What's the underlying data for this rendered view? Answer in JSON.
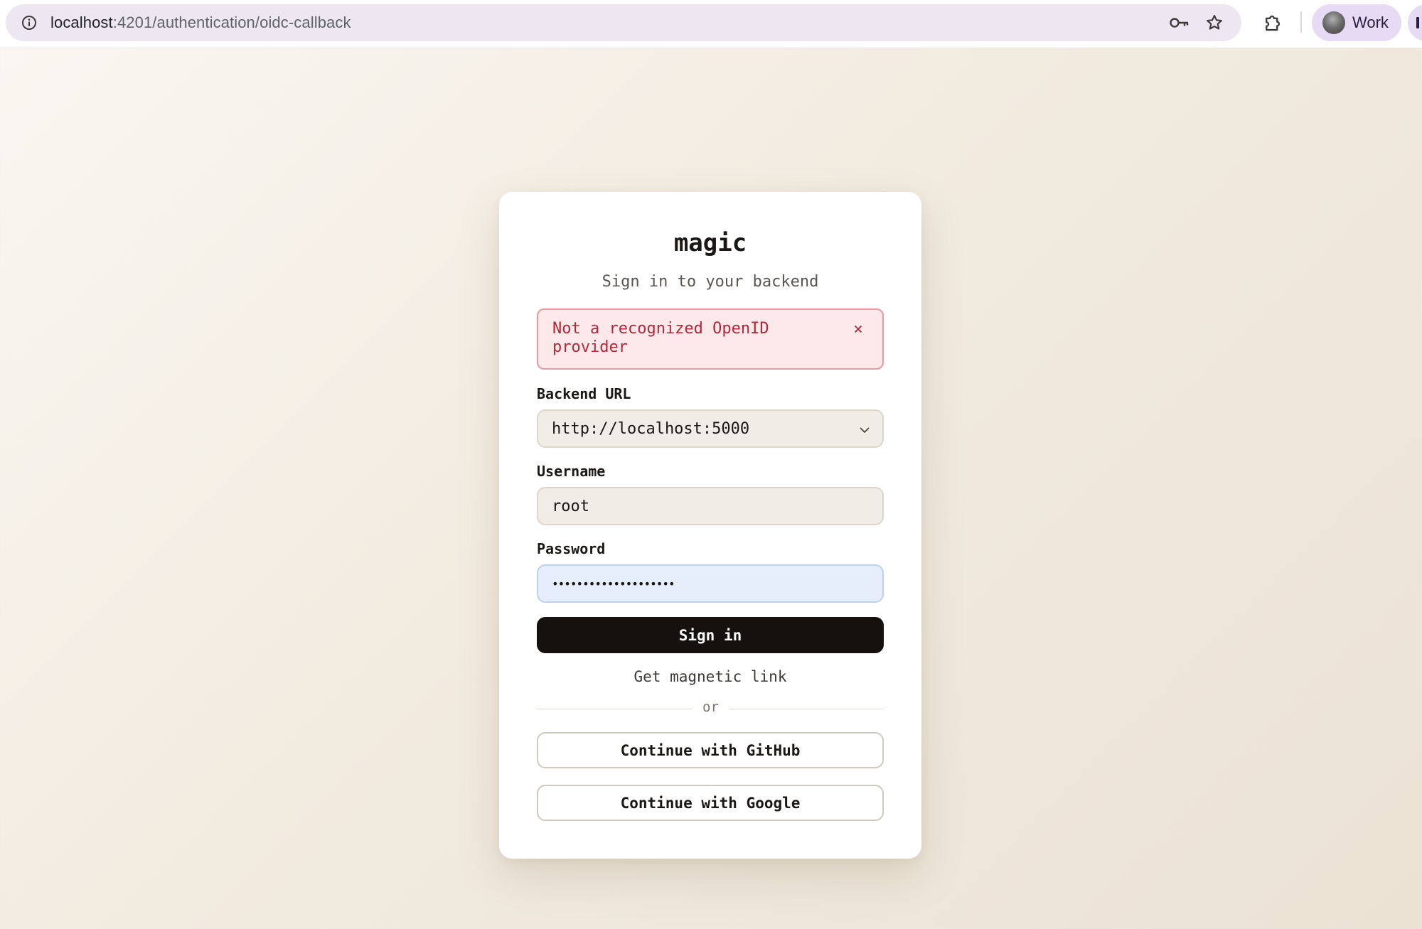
{
  "browser": {
    "url_host": "localhost",
    "url_path": ":4201/authentication/oidc-callback",
    "profile_label": "Work"
  },
  "card": {
    "title": "magic",
    "subtitle": "Sign in to your backend",
    "alert": {
      "message": "Not a recognized OpenID provider",
      "close_glyph": "×"
    },
    "backend_url": {
      "label": "Backend URL",
      "value": "http://localhost:5000"
    },
    "username": {
      "label": "Username",
      "value": "root"
    },
    "password": {
      "label": "Password",
      "masked_value": "••••••••••••••••••••"
    },
    "sign_in_label": "Sign in",
    "magic_link_label": "Get magnetic link",
    "divider_label": "or",
    "github_label": "Continue with GitHub",
    "google_label": "Continue with Google"
  },
  "colors": {
    "primary_button": "#15110e",
    "alert_text": "#b0283a",
    "alert_bg": "#fde8ea",
    "password_field_bg": "#e6eefc"
  }
}
